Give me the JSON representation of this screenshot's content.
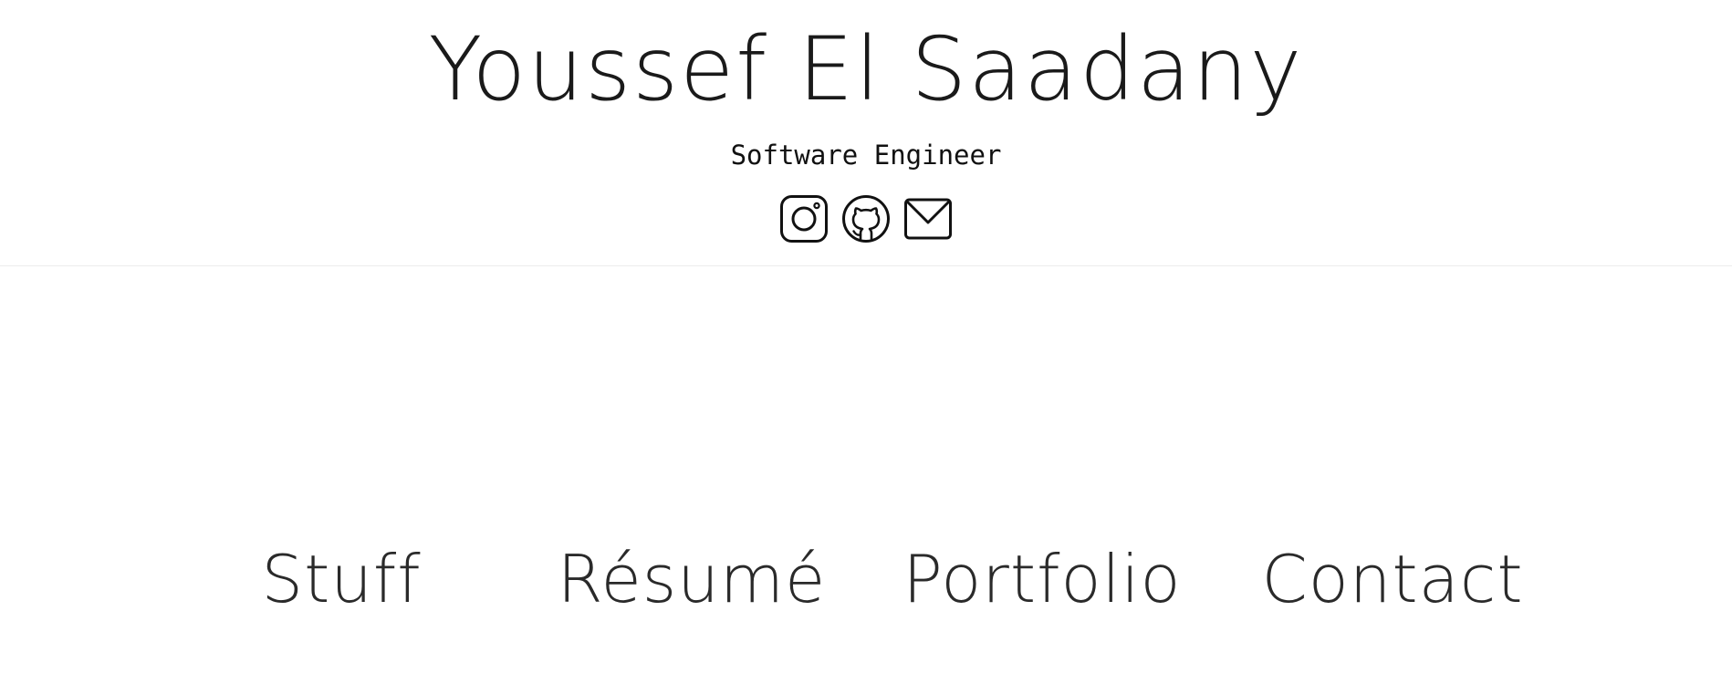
{
  "header": {
    "name": "Youssef El Saadany",
    "subtitle": "Software Engineer",
    "socials": [
      {
        "icon": "instagram-icon"
      },
      {
        "icon": "github-icon"
      },
      {
        "icon": "mail-icon"
      }
    ]
  },
  "nav": {
    "items": [
      {
        "label": "Stuff"
      },
      {
        "label": "Résumé"
      },
      {
        "label": "Portfolio"
      },
      {
        "label": "Contact"
      }
    ]
  },
  "colors": {
    "text": "#1a1a1a",
    "background": "#ffffff",
    "divider": "#ececec"
  }
}
